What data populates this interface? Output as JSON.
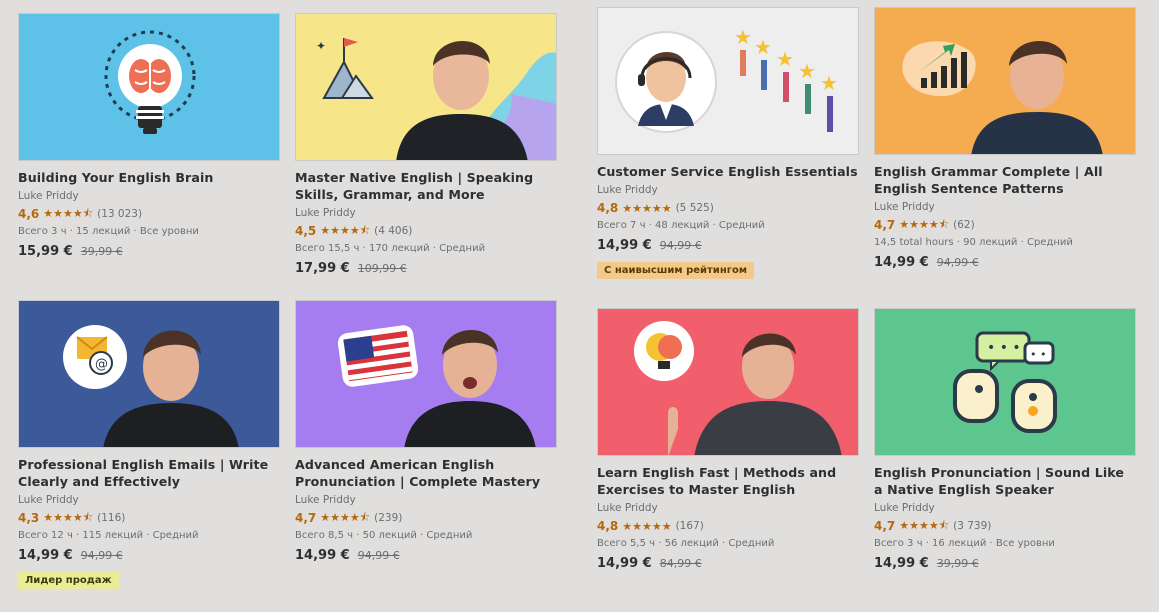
{
  "courses": [
    {
      "title": "Building Your English Brain",
      "author": "Luke Priddy",
      "rating": "4,6",
      "stars": "★★★★⯪",
      "reviews": "(13 023)",
      "meta": "Всего 3 ч · 15 лекций · Все уровни",
      "price": "15,99 €",
      "old_price": "39,99 €",
      "badge": ""
    },
    {
      "title": "Master Native English | Speaking Skills, Grammar, and More",
      "author": "Luke Priddy",
      "rating": "4,5",
      "stars": "★★★★⯪",
      "reviews": "(4 406)",
      "meta": "Всего 15,5 ч · 170 лекций · Средний",
      "price": "17,99 €",
      "old_price": "109,99 €",
      "badge": ""
    },
    {
      "title": "Customer Service English Essentials",
      "author": "Luke Priddy",
      "rating": "4,8",
      "stars": "★★★★★",
      "reviews": "(5 525)",
      "meta": "Всего 7 ч · 48 лекций · Средний",
      "price": "14,99 €",
      "old_price": "94,99 €",
      "badge": "С наивысшим рейтингом"
    },
    {
      "title": "English Grammar Complete | All English Sentence Patterns",
      "author": "Luke Priddy",
      "rating": "4,7",
      "stars": "★★★★⯪",
      "reviews": "(62)",
      "meta": "14,5 total hours · 90 лекций · Средний",
      "price": "14,99 €",
      "old_price": "94,99 €",
      "badge": ""
    },
    {
      "title": "Professional English Emails | Write Clearly and Effectively",
      "author": "Luke Priddy",
      "rating": "4,3",
      "stars": "★★★★⯪",
      "reviews": "(116)",
      "meta": "Всего 12 ч · 115 лекций · Средний",
      "price": "14,99 €",
      "old_price": "94,99 €",
      "badge": "Лидер продаж"
    },
    {
      "title": "Advanced American English Pronunciation | Complete Mastery",
      "author": "Luke Priddy",
      "rating": "4,7",
      "stars": "★★★★⯪",
      "reviews": "(239)",
      "meta": "Всего 8,5 ч · 50 лекций · Средний",
      "price": "14,99 €",
      "old_price": "94,99 €",
      "badge": ""
    },
    {
      "title": "Learn English Fast | Methods and Exercises to Master English",
      "author": "Luke Priddy",
      "rating": "4,8",
      "stars": "★★★★★",
      "reviews": "(167)",
      "meta": "Всего 5,5 ч · 56 лекций · Средний",
      "price": "14,99 €",
      "old_price": "84,99 €",
      "badge": ""
    },
    {
      "title": "English Pronunciation | Sound Like a Native English Speaker",
      "author": "Luke Priddy",
      "rating": "4,7",
      "stars": "★★★★⯪",
      "reviews": "(3 739)",
      "meta": "Всего 3 ч · 16 лекций · Все уровни",
      "price": "14,99 €",
      "old_price": "39,99 €",
      "badge": ""
    }
  ],
  "colors": {
    "rating": "#b4690e",
    "badge_bestseller": "#eceb98",
    "badge_top_rated": "#f3ca8c"
  }
}
